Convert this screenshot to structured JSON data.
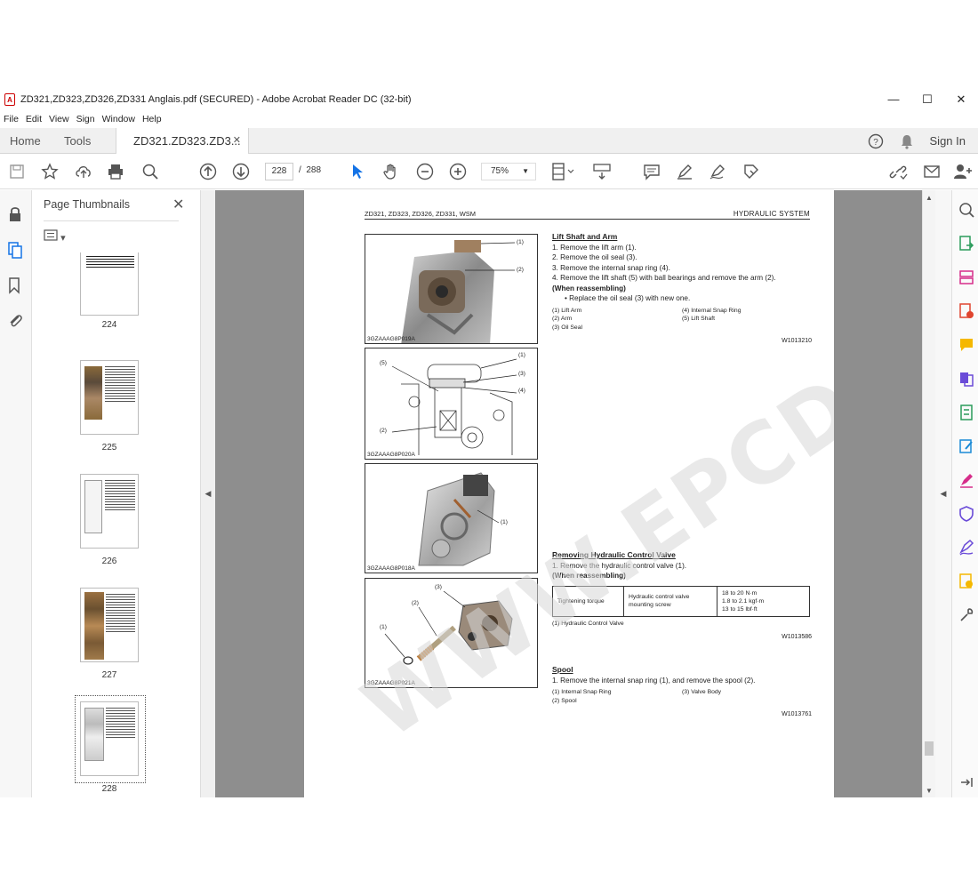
{
  "window": {
    "title": "ZD321,ZD323,ZD326,ZD331 Anglais.pdf (SECURED) - Adobe Acrobat Reader DC (32-bit)",
    "minimize": "—",
    "maximize": "☐",
    "close": "✕"
  },
  "menu": [
    "File",
    "Edit",
    "View",
    "Sign",
    "Window",
    "Help"
  ],
  "tabs": {
    "home": "Home",
    "tools": "Tools",
    "document": "ZD321.ZD323.ZD3...",
    "document_close": "✕",
    "sign_in": "Sign In"
  },
  "toolbar": {
    "current_page": "228",
    "page_separator": "/",
    "total_pages": "288",
    "zoom": "75%"
  },
  "panel": {
    "title": "Page Thumbnails",
    "close": "✕",
    "options": "▾",
    "thumbnails": [
      {
        "label": "224"
      },
      {
        "label": "225"
      },
      {
        "label": "226"
      },
      {
        "label": "227"
      },
      {
        "label": "228"
      }
    ]
  },
  "page": {
    "header_left": "ZD321, ZD323, ZD326, ZD331, WSM",
    "header_right": "HYDRAULIC  SYSTEM",
    "figures": [
      {
        "id": "3GZAAAG8P019A",
        "callouts": [
          "(1)",
          "(2)"
        ]
      },
      {
        "id": "3GZAAAG8P020A",
        "callouts": [
          "(1)",
          "(3)",
          "(4)",
          "(5)",
          "(2)"
        ]
      },
      {
        "id": "3GZAAAG8P018A",
        "callouts": [
          "(1)"
        ]
      },
      {
        "id": "3GZAAAG8P021A",
        "callouts": [
          "(3)",
          "(2)",
          "(1)"
        ]
      }
    ],
    "lift_shaft": {
      "heading": "Lift Shaft and Arm",
      "steps": [
        "1.  Remove the lift arm (1).",
        "2.  Remove the oil seal (3).",
        "3.  Remove the internal snap ring (4).",
        "4.  Remove the lift shaft (5) with ball bearings and remove the arm (2)."
      ],
      "reassembling": "(When reassembling)",
      "bullet": "•  Replace the oil seal (3) with new one.",
      "legend": [
        "(1)  Lift Arm",
        "(4)  Internal Snap Ring",
        "(2)  Arm",
        "(5)  Lift Shaft",
        "(3)  Oil Seal",
        ""
      ],
      "ref": "W1013210"
    },
    "control_valve": {
      "heading": "Removing Hydraulic Control Valve",
      "steps": [
        "1.  Remove the hydraulic control valve (1)."
      ],
      "reassembling": "(When reassembling)",
      "table": {
        "label": "Tightening torque",
        "item": "Hydraulic control valve mounting screw",
        "values": [
          "18 to 20 N·m",
          "1.8 to 2.1 kgf·m",
          "13 to 15 lbf·ft"
        ]
      },
      "legend": [
        "(1)  Hydraulic Control Valve"
      ],
      "ref": "W1013586"
    },
    "spool": {
      "heading": "Spool",
      "steps": [
        "1.  Remove the internal snap ring (1), and remove the spool (2)."
      ],
      "legend": [
        "(1)  Internal Snap Ring",
        "(3)  Valve Body",
        "(2)  Spool",
        ""
      ],
      "ref": "W1013761"
    },
    "watermark": "WWW.EPCDEPO.COM"
  },
  "colors": {
    "accent": "#1473e6",
    "pdf_red": "#cc0000",
    "viewer_bg": "#8e8e8e"
  }
}
